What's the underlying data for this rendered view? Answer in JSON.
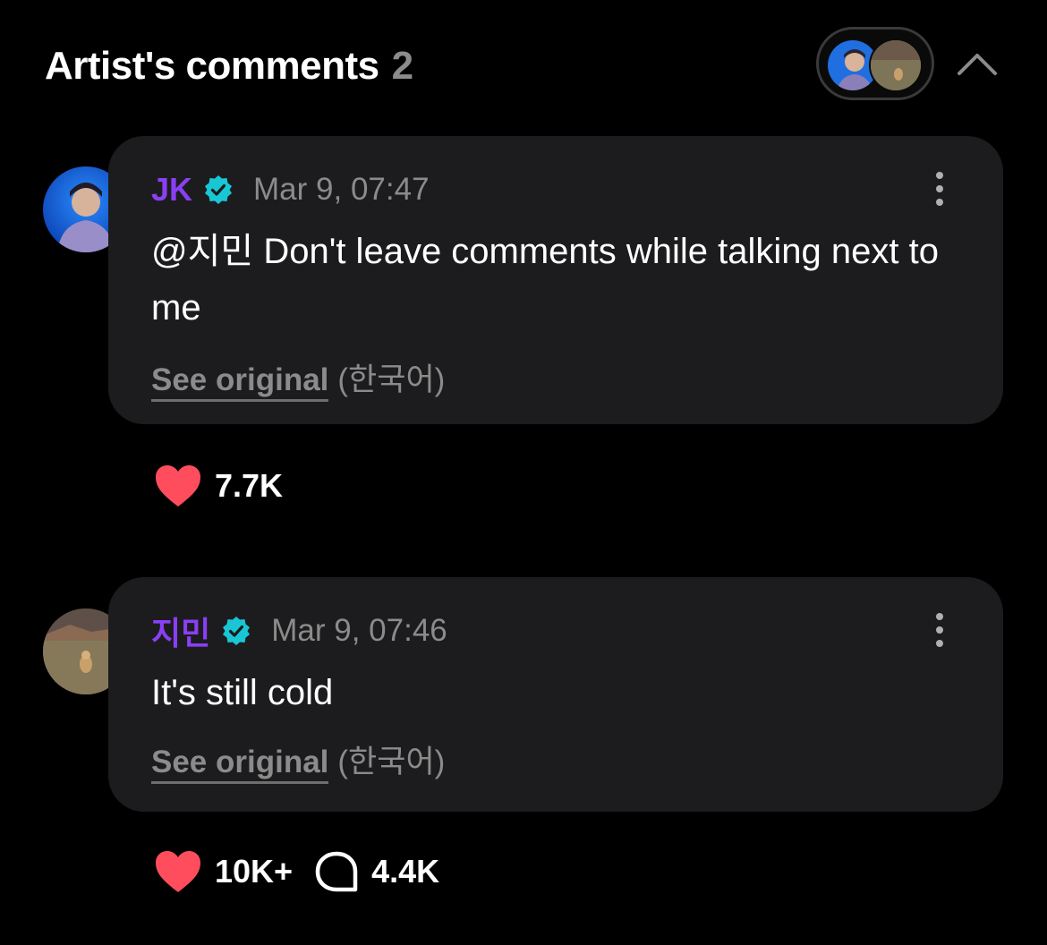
{
  "header": {
    "title": "Artist's comments",
    "count": "2"
  },
  "comments": [
    {
      "author": "JK",
      "author_color": "#8a3ff5",
      "verified": true,
      "time": "Mar 9, 07:47",
      "text": "@지민 Don't leave comments while talking next to me",
      "see_original": "See original",
      "language": "(한국어)",
      "likes": "7.7K"
    },
    {
      "author": "지민",
      "author_color": "#8a3ff5",
      "verified": true,
      "time": "Mar 9, 07:46",
      "text": "It's still cold",
      "see_original": "See original",
      "language": "(한국어)",
      "likes": "10K+",
      "replies": "4.4K"
    }
  ],
  "icons": {
    "verified": "verified-badge-icon",
    "like": "heart-icon",
    "reply": "speech-bubble-icon",
    "more": "more-vertical-icon",
    "collapse": "chevron-up-icon"
  },
  "colors": {
    "background": "#000000",
    "card": "#1c1c1e",
    "accent": "#8a3ff5",
    "verified": "#19c7d4",
    "heart": "#ff4d5e",
    "muted": "#8b8b8b"
  }
}
